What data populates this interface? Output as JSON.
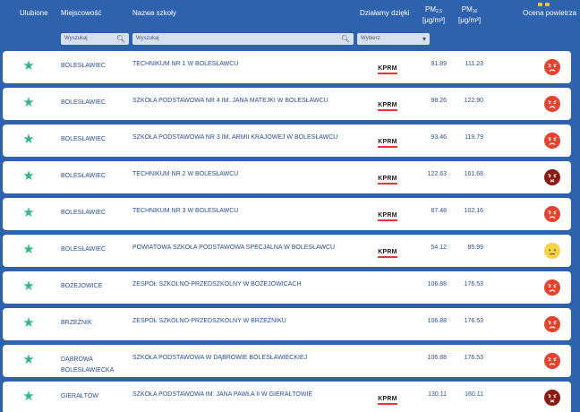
{
  "header": {
    "favorites": "Ulubione",
    "city": "Miejscowość",
    "school": "Nazwa szkoły",
    "partners": "Działamy dzięki",
    "pm25_label": "PM",
    "pm25_sub": "2.5",
    "pm25_unit": "[μg/m³]",
    "pm10_label": "PM",
    "pm10_sub": "10",
    "pm10_unit": "[μg/m³]",
    "rating": "Ocena powietrza"
  },
  "filters": {
    "city_placeholder": "Wyszukaj",
    "school_placeholder": "Wyszukaj",
    "partner_select": "Wybierz"
  },
  "colors": {
    "header_bg": "#2e62ad",
    "star": "#37b58c",
    "kprm_underline": "#e53935",
    "bad": "#e2442f",
    "very_bad": "#8b1a12",
    "moderate": "#f3d34a"
  },
  "rows": [
    {
      "city": "BOLESŁAWIEC",
      "school": "TECHNIKUM NR 1 W BOLESŁAWCU",
      "partner": "KPRM",
      "pm25": "91.89",
      "pm10": "111.23",
      "rating": "bad"
    },
    {
      "city": "BOLESŁAWIEC",
      "school": "SZKOŁA PODSTAWOWA NR 4 IM. JANA MATEJKI W BOLESŁAWCU",
      "partner": "KPRM",
      "pm25": "98.26",
      "pm10": "122.90",
      "rating": "bad"
    },
    {
      "city": "BOLESŁAWIEC",
      "school": "SZKOŁA PODSTAWOWA NR 3 IM. ARMII KRAJOWEJ W BOLESŁAWCU",
      "partner": "KPRM",
      "pm25": "93.46",
      "pm10": "119.79",
      "rating": "bad"
    },
    {
      "city": "BOLESŁAWIEC",
      "school": "TECHNIKUM NR 2 W BOLESŁAWCU",
      "partner": "KPRM",
      "pm25": "122.63",
      "pm10": "161.68",
      "rating": "very-bad"
    },
    {
      "city": "BOLESŁAWIEC",
      "school": "TECHNIKUM NR 3 W BOLESŁAWCU",
      "partner": "KPRM",
      "pm25": "87.48",
      "pm10": "102.16",
      "rating": "bad"
    },
    {
      "city": "BOLESŁAWIEC",
      "school": "POWIATOWA SZKOŁA PODSTAWOWA SPECJALNA W BOLESŁAWCU",
      "partner": "KPRM",
      "pm25": "54.12",
      "pm10": "85.99",
      "rating": "moderate"
    },
    {
      "city": "BOŻEJOWICE",
      "school": "ZESPÓŁ SZKOLNO-PRZEDSZKOLNY W BOŻEJOWICACH",
      "partner": "",
      "pm25": "106.88",
      "pm10": "176.53",
      "rating": "bad"
    },
    {
      "city": "BRZEŹNIK",
      "school": "ZESPÓŁ SZKOLNO-PRZEDSZKOLNY W BRZEŹNIKU",
      "partner": "",
      "pm25": "106.88",
      "pm10": "176.53",
      "rating": "bad"
    },
    {
      "city": "DĄBROWA BOLESŁAWIECKA",
      "school": "SZKOŁA PODSTAWOWA W DĄBROWIE BOLESŁAWIECKIEJ",
      "partner": "",
      "pm25": "106.88",
      "pm10": "176.53",
      "rating": "bad"
    },
    {
      "city": "GIERAŁTÓW",
      "school": "SZKOŁA PODSTAWOWA IM. JANA PAWŁA II W GIERAŁTOWIE",
      "partner": "KPRM",
      "pm25": "130.11",
      "pm10": "160.11",
      "rating": "very-bad"
    }
  ]
}
